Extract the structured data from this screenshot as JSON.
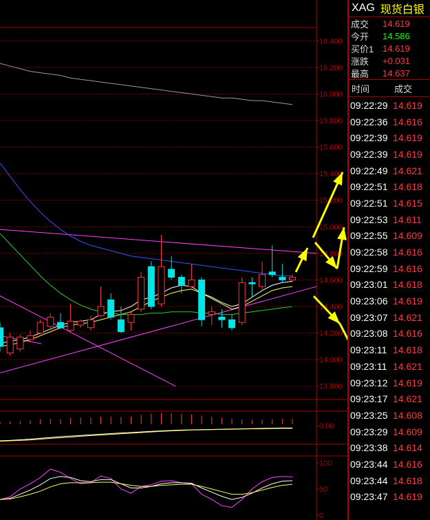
{
  "panel": {
    "symbol": "XAG",
    "name": "现货白银",
    "quote": [
      {
        "label": "成交",
        "value": "14.619",
        "color": "red"
      },
      {
        "label": "今开",
        "value": "14.586",
        "color": "green"
      },
      {
        "label": "买价1",
        "value": "14.619",
        "color": "red"
      },
      {
        "label": "涨跌",
        "value": "+0.031",
        "color": "red"
      },
      {
        "label": "最高",
        "value": "14.637",
        "color": "red"
      }
    ],
    "ticks_header": {
      "time": "时间",
      "price": "成交"
    },
    "ticks": [
      {
        "time": "09:22:29",
        "price": "14.619"
      },
      {
        "time": "09:22:36",
        "price": "14.616"
      },
      {
        "time": "09:22:39",
        "price": "14.619"
      },
      {
        "time": "09:22:39",
        "price": "14.619"
      },
      {
        "time": "09:22:49",
        "price": "14.621"
      },
      {
        "time": "09:22:51",
        "price": "14.618"
      },
      {
        "time": "09:22:51",
        "price": "14.615"
      },
      {
        "time": "09:22:53",
        "price": "14.611"
      },
      {
        "time": "09:22:55",
        "price": "14.609"
      },
      {
        "time": "09:22:58",
        "price": "14.616"
      },
      {
        "time": "09:22:59",
        "price": "14.616"
      },
      {
        "time": "09:23:01",
        "price": "14.618"
      },
      {
        "time": "09:23:06",
        "price": "14.619"
      },
      {
        "time": "09:23:07",
        "price": "14.621"
      },
      {
        "time": "09:23:08",
        "price": "14.616"
      },
      {
        "time": "09:23:11",
        "price": "14.618"
      },
      {
        "time": "09:23:11",
        "price": "14.621"
      },
      {
        "time": "09:23:12",
        "price": "14.619"
      },
      {
        "time": "09:23:17",
        "price": "14.621"
      },
      {
        "time": "09:23:25",
        "price": "14.608"
      },
      {
        "time": "09:23:29",
        "price": "14.609"
      },
      {
        "time": "09:23:38",
        "price": "14.614"
      },
      {
        "time": "09:23:44",
        "price": "14.616"
      },
      {
        "time": "09:23:44",
        "price": "14.618"
      },
      {
        "time": "09:23:47",
        "price": "14.619"
      }
    ]
  },
  "colors": {
    "up": "#ff3b3b",
    "down": "#00e5e5",
    "grid": "#b00000",
    "axis_text": "#b00000",
    "ma_white": "#ffffff",
    "ma_yellow": "#ffff66",
    "ma_green": "#33cc33",
    "ma_blue": "#3355ff",
    "ma_gray": "#9a9a9a",
    "trend_magenta": "#ff44ff",
    "arrow": "#ffff00"
  },
  "chart_data": [
    {
      "type": "candlestick",
      "ylim": [
        13.7,
        16.5
      ],
      "y_ticks": [
        "16.400",
        "16.200",
        "16.000",
        "15.800",
        "15.600",
        "15.400",
        "15.200",
        "15.000",
        "14.800",
        "14.600",
        "14.400",
        "14.200",
        "14.000",
        "13.800"
      ],
      "candles": [
        {
          "o": 14.24,
          "c": 14.1,
          "h": 14.28,
          "l": 14.06
        },
        {
          "o": 14.05,
          "c": 14.17,
          "h": 14.2,
          "l": 14.03
        },
        {
          "o": 14.08,
          "c": 14.17,
          "h": 14.19,
          "l": 14.06
        },
        {
          "o": 14.15,
          "c": 14.18,
          "h": 14.22,
          "l": 14.13
        },
        {
          "o": 14.2,
          "c": 14.28,
          "h": 14.3,
          "l": 14.19
        },
        {
          "o": 14.25,
          "c": 14.32,
          "h": 14.35,
          "l": 14.24
        },
        {
          "o": 14.28,
          "c": 14.24,
          "h": 14.35,
          "l": 14.23
        },
        {
          "o": 14.22,
          "c": 14.29,
          "h": 14.42,
          "l": 14.21
        },
        {
          "o": 14.26,
          "c": 14.29,
          "h": 14.3,
          "l": 14.24
        },
        {
          "o": 14.24,
          "c": 14.3,
          "h": 14.33,
          "l": 14.22
        },
        {
          "o": 14.33,
          "c": 14.4,
          "h": 14.55,
          "l": 14.32
        },
        {
          "o": 14.45,
          "c": 14.32,
          "h": 14.5,
          "l": 14.3
        },
        {
          "o": 14.3,
          "c": 14.21,
          "h": 14.4,
          "l": 14.2
        },
        {
          "o": 14.28,
          "c": 14.34,
          "h": 14.36,
          "l": 14.22
        },
        {
          "o": 14.38,
          "c": 14.62,
          "h": 14.66,
          "l": 14.36
        },
        {
          "o": 14.7,
          "c": 14.4,
          "h": 14.74,
          "l": 14.38
        },
        {
          "o": 14.42,
          "c": 14.7,
          "h": 14.94,
          "l": 14.4
        },
        {
          "o": 14.68,
          "c": 14.62,
          "h": 14.78,
          "l": 14.6
        },
        {
          "o": 14.62,
          "c": 14.56,
          "h": 14.64,
          "l": 14.5
        },
        {
          "o": 14.55,
          "c": 14.6,
          "h": 14.72,
          "l": 14.54
        },
        {
          "o": 14.6,
          "c": 14.3,
          "h": 14.62,
          "l": 14.25
        },
        {
          "o": 14.34,
          "c": 14.36,
          "h": 14.4,
          "l": 14.26
        },
        {
          "o": 14.32,
          "c": 14.3,
          "h": 14.38,
          "l": 14.24
        },
        {
          "o": 14.3,
          "c": 14.24,
          "h": 14.34,
          "l": 14.22
        },
        {
          "o": 14.28,
          "c": 14.58,
          "h": 14.62,
          "l": 14.26
        },
        {
          "o": 14.58,
          "c": 14.57,
          "h": 14.62,
          "l": 14.47
        },
        {
          "o": 14.55,
          "c": 14.64,
          "h": 14.74,
          "l": 14.53
        },
        {
          "o": 14.66,
          "c": 14.64,
          "h": 14.86,
          "l": 14.62
        },
        {
          "o": 14.62,
          "c": 14.6,
          "h": 14.72,
          "l": 14.58
        },
        {
          "o": 14.6,
          "c": 14.62,
          "h": 14.64,
          "l": 14.58
        }
      ],
      "series": [
        {
          "values": [
            14.12,
            14.14,
            14.15,
            14.17,
            14.2,
            14.23,
            14.26,
            14.28,
            14.29,
            14.3,
            14.34,
            14.36,
            14.37,
            14.4,
            14.45,
            14.47,
            14.5,
            14.54,
            14.56,
            14.55,
            14.5,
            14.47,
            14.43,
            14.4,
            14.42,
            14.47,
            14.52,
            14.56,
            14.58,
            14.59
          ]
        },
        {
          "values": [
            14.1,
            14.11,
            14.13,
            14.15,
            14.18,
            14.21,
            14.24,
            14.26,
            14.27,
            14.28,
            14.3,
            14.32,
            14.34,
            14.36,
            14.4,
            14.44,
            14.47,
            14.5,
            14.52,
            14.53,
            14.5,
            14.46,
            14.42,
            14.38,
            14.4,
            14.44,
            14.48,
            14.52,
            14.54,
            14.55
          ]
        },
        {
          "values": [
            14.95,
            14.87,
            14.79,
            14.71,
            14.63,
            14.56,
            14.5,
            14.45,
            14.41,
            14.38,
            14.36,
            14.35,
            14.34,
            14.34,
            14.34,
            14.35,
            14.35,
            14.36,
            14.36,
            14.36,
            14.35,
            14.35,
            14.34,
            14.34,
            14.35,
            14.36,
            14.37,
            14.38,
            14.39,
            14.4
          ]
        },
        {
          "values": [
            15.48,
            15.38,
            15.28,
            15.19,
            15.11,
            15.04,
            14.98,
            14.93,
            14.89,
            14.86,
            14.84,
            14.82,
            14.8,
            14.78,
            14.77,
            14.76,
            14.75,
            14.74,
            14.73,
            14.72,
            14.71,
            14.7,
            14.69,
            14.68,
            14.67,
            14.66,
            14.65,
            14.64,
            14.63,
            14.63
          ]
        },
        {
          "values": [
            16.23,
            16.21,
            16.19,
            16.17,
            16.16,
            16.15,
            16.14,
            16.12,
            16.11,
            16.1,
            16.09,
            16.08,
            16.07,
            16.06,
            16.05,
            16.04,
            16.03,
            16.02,
            16.01,
            16.0,
            15.99,
            15.98,
            15.97,
            15.97,
            15.96,
            15.95,
            15.95,
            15.94,
            15.93,
            15.92
          ]
        }
      ]
    },
    {
      "type": "bar",
      "y_ticks": [
        "0.00"
      ],
      "values": [
        0.2,
        0.25,
        0.3,
        0.35,
        0.45,
        0.5,
        0.45,
        0.55,
        0.6,
        0.6,
        0.7,
        0.7,
        0.65,
        0.7,
        0.85,
        0.95,
        1.0,
        1.0,
        0.95,
        0.9,
        0.8,
        0.7,
        0.6,
        0.5,
        0.45,
        0.4,
        0.42,
        0.45,
        0.48,
        0.5
      ],
      "series": [
        {
          "values": [
            0.1,
            0.12,
            0.15,
            0.18,
            0.22,
            0.26,
            0.3,
            0.33,
            0.36,
            0.39,
            0.42,
            0.45,
            0.48,
            0.5,
            0.53,
            0.56,
            0.58,
            0.6,
            0.62,
            0.63,
            0.64,
            0.65,
            0.66,
            0.67,
            0.68,
            0.69,
            0.7,
            0.71,
            0.72,
            0.72
          ]
        },
        {
          "values": [
            0.08,
            0.1,
            0.12,
            0.14,
            0.18,
            0.22,
            0.25,
            0.28,
            0.32,
            0.35,
            0.38,
            0.41,
            0.44,
            0.47,
            0.5,
            0.53,
            0.56,
            0.58,
            0.6,
            0.62,
            0.63,
            0.64,
            0.65,
            0.66,
            0.67,
            0.68,
            0.68,
            0.69,
            0.7,
            0.7
          ]
        }
      ]
    },
    {
      "type": "line",
      "ylim": [
        0,
        100
      ],
      "y_ticks": [
        "100",
        "50",
        "0"
      ],
      "series": [
        {
          "values": [
            30,
            35,
            50,
            60,
            72,
            88,
            82,
            70,
            60,
            62,
            75,
            70,
            50,
            42,
            55,
            58,
            65,
            66,
            62,
            60,
            40,
            30,
            18,
            15,
            30,
            50,
            64,
            72,
            74,
            73
          ]
        },
        {
          "values": [
            30,
            32,
            40,
            48,
            58,
            70,
            74,
            72,
            66,
            64,
            68,
            68,
            60,
            52,
            52,
            55,
            60,
            62,
            62,
            61,
            52,
            44,
            36,
            30,
            34,
            42,
            52,
            60,
            65,
            66
          ]
        },
        {
          "values": [
            30,
            31,
            35,
            40,
            46,
            54,
            60,
            62,
            62,
            62,
            63,
            63,
            60,
            57,
            55,
            55,
            57,
            58,
            59,
            59,
            55,
            50,
            45,
            40,
            40,
            43,
            48,
            53,
            57,
            59
          ]
        }
      ]
    }
  ]
}
